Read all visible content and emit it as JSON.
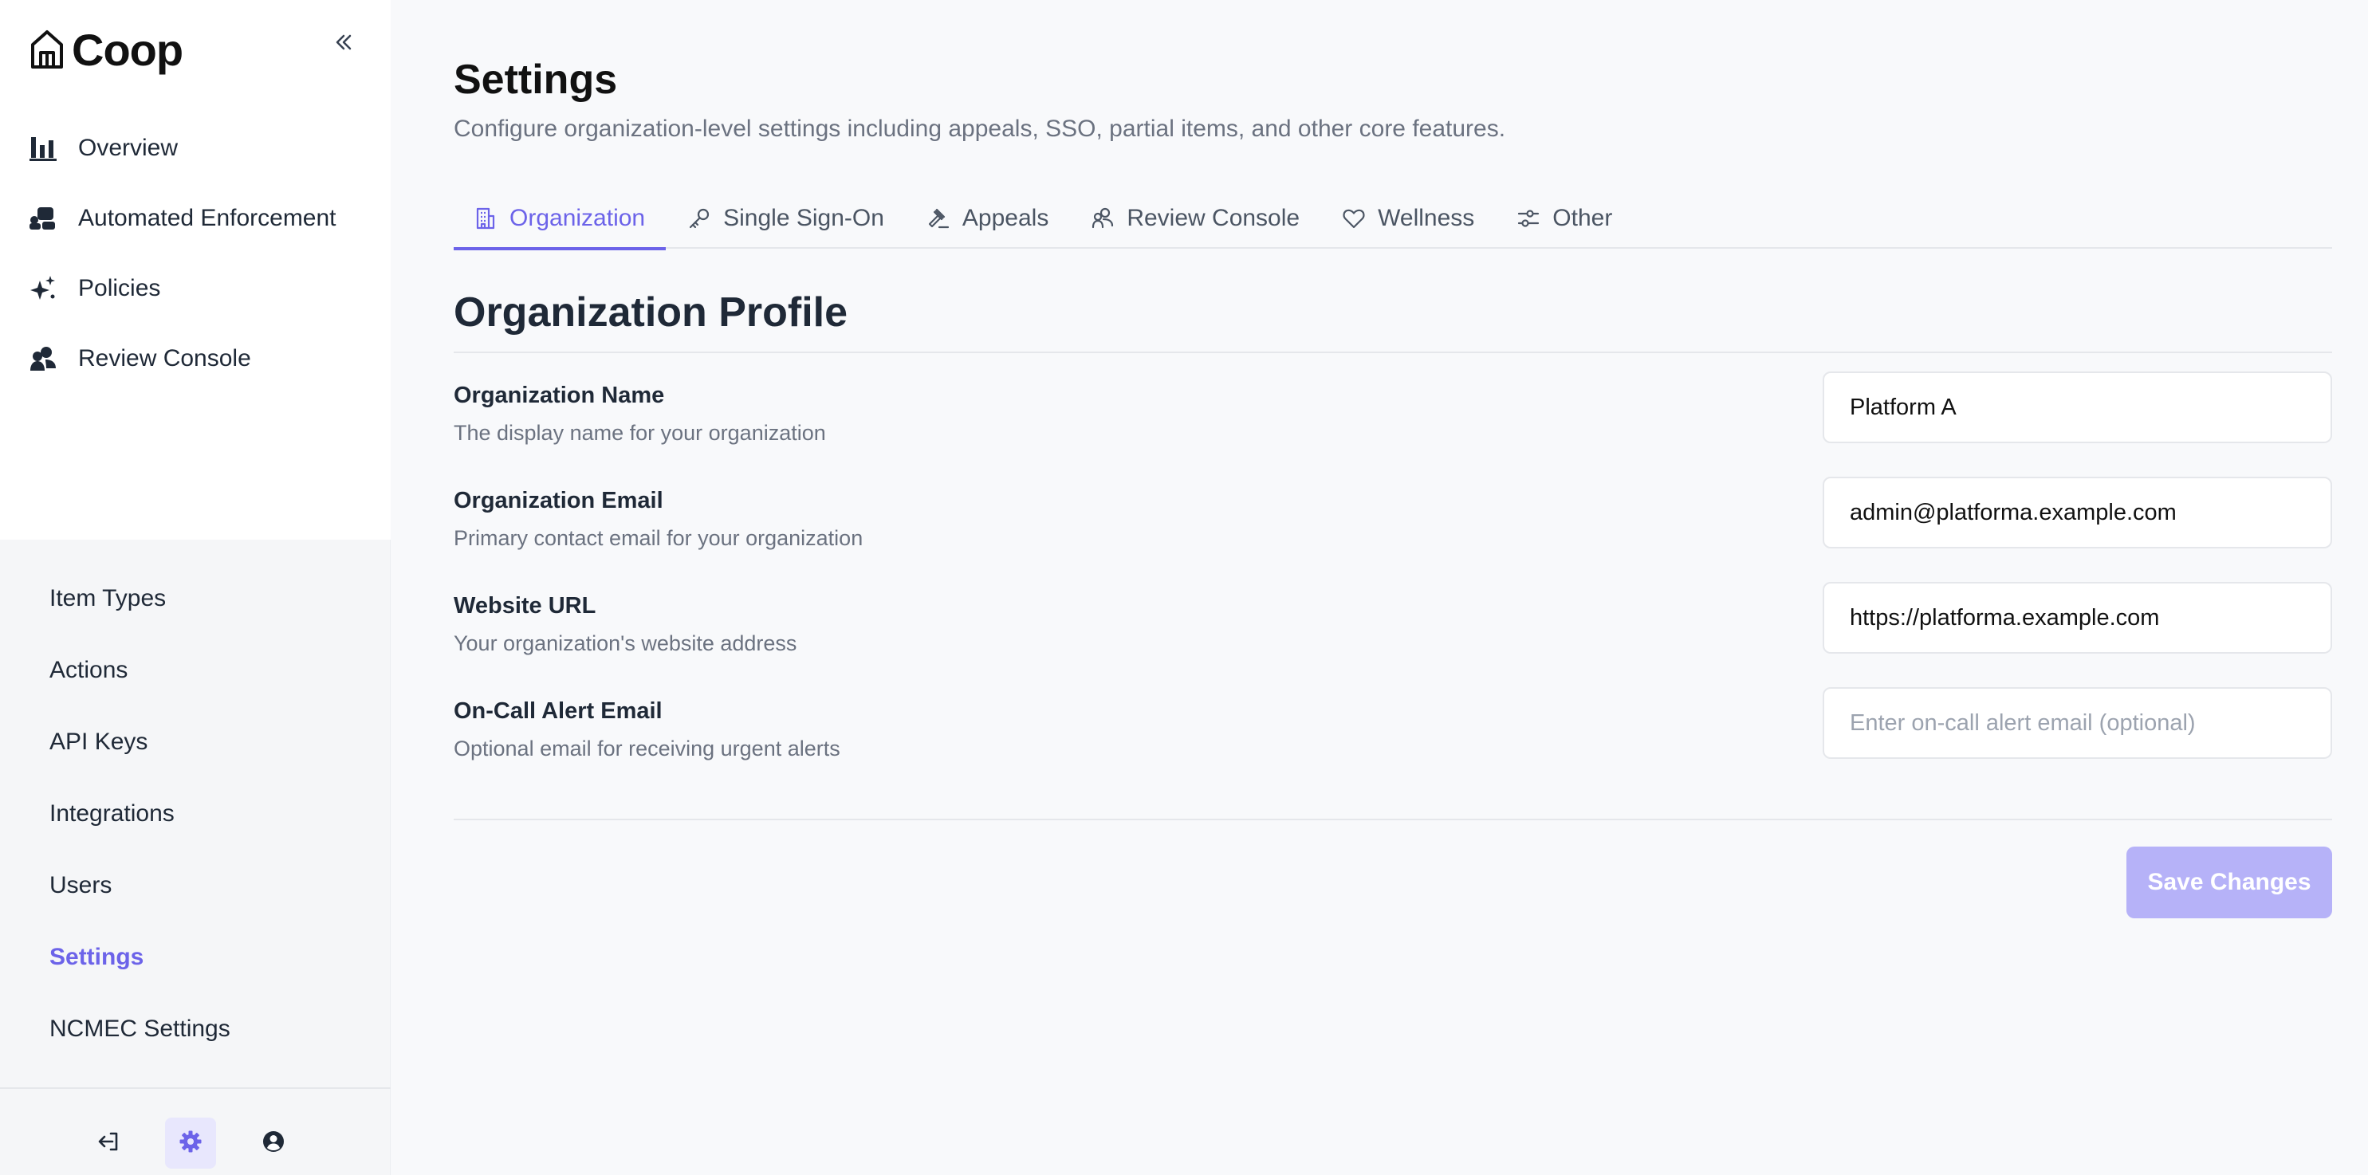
{
  "brand": {
    "name": "Coop"
  },
  "sidebar": {
    "main_items": [
      {
        "label": "Overview",
        "icon": "bar-chart-icon"
      },
      {
        "label": "Automated Enforcement",
        "icon": "robot-icon"
      },
      {
        "label": "Policies",
        "icon": "sparkles-icon"
      },
      {
        "label": "Review Console",
        "icon": "users-icon"
      }
    ],
    "secondary_items": [
      {
        "label": "Item Types",
        "active": false
      },
      {
        "label": "Actions",
        "active": false
      },
      {
        "label": "API Keys",
        "active": false
      },
      {
        "label": "Integrations",
        "active": false
      },
      {
        "label": "Users",
        "active": false
      },
      {
        "label": "Settings",
        "active": true
      },
      {
        "label": "NCMEC Settings",
        "active": false
      }
    ],
    "footer": [
      "logout-icon",
      "gear-icon",
      "user-circle-icon"
    ]
  },
  "page": {
    "title": "Settings",
    "subtitle": "Configure organization-level settings including appeals, SSO, partial items, and other core features."
  },
  "tabs": [
    {
      "label": "Organization",
      "icon": "building-icon",
      "active": true
    },
    {
      "label": "Single Sign-On",
      "icon": "key-icon",
      "active": false
    },
    {
      "label": "Appeals",
      "icon": "gavel-icon",
      "active": false
    },
    {
      "label": "Review Console",
      "icon": "users-icon",
      "active": false
    },
    {
      "label": "Wellness",
      "icon": "heart-icon",
      "active": false
    },
    {
      "label": "Other",
      "icon": "sliders-icon",
      "active": false
    }
  ],
  "profile": {
    "title": "Organization Profile",
    "fields": [
      {
        "label": "Organization Name",
        "help": "The display name for your organization",
        "value": "Platform A",
        "placeholder": ""
      },
      {
        "label": "Organization Email",
        "help": "Primary contact email for your organization",
        "value": "admin@platforma.example.com",
        "placeholder": ""
      },
      {
        "label": "Website URL",
        "help": "Your organization's website address",
        "value": "https://platforma.example.com",
        "placeholder": ""
      },
      {
        "label": "On-Call Alert Email",
        "help": "Optional email for receiving urgent alerts",
        "value": "",
        "placeholder": "Enter on-call alert email (optional)"
      }
    ],
    "save_label": "Save Changes"
  },
  "colors": {
    "accent": "#6c63e9",
    "save_disabled": "#b6b2f8",
    "active_icon_bg": "#e8e7fd"
  }
}
